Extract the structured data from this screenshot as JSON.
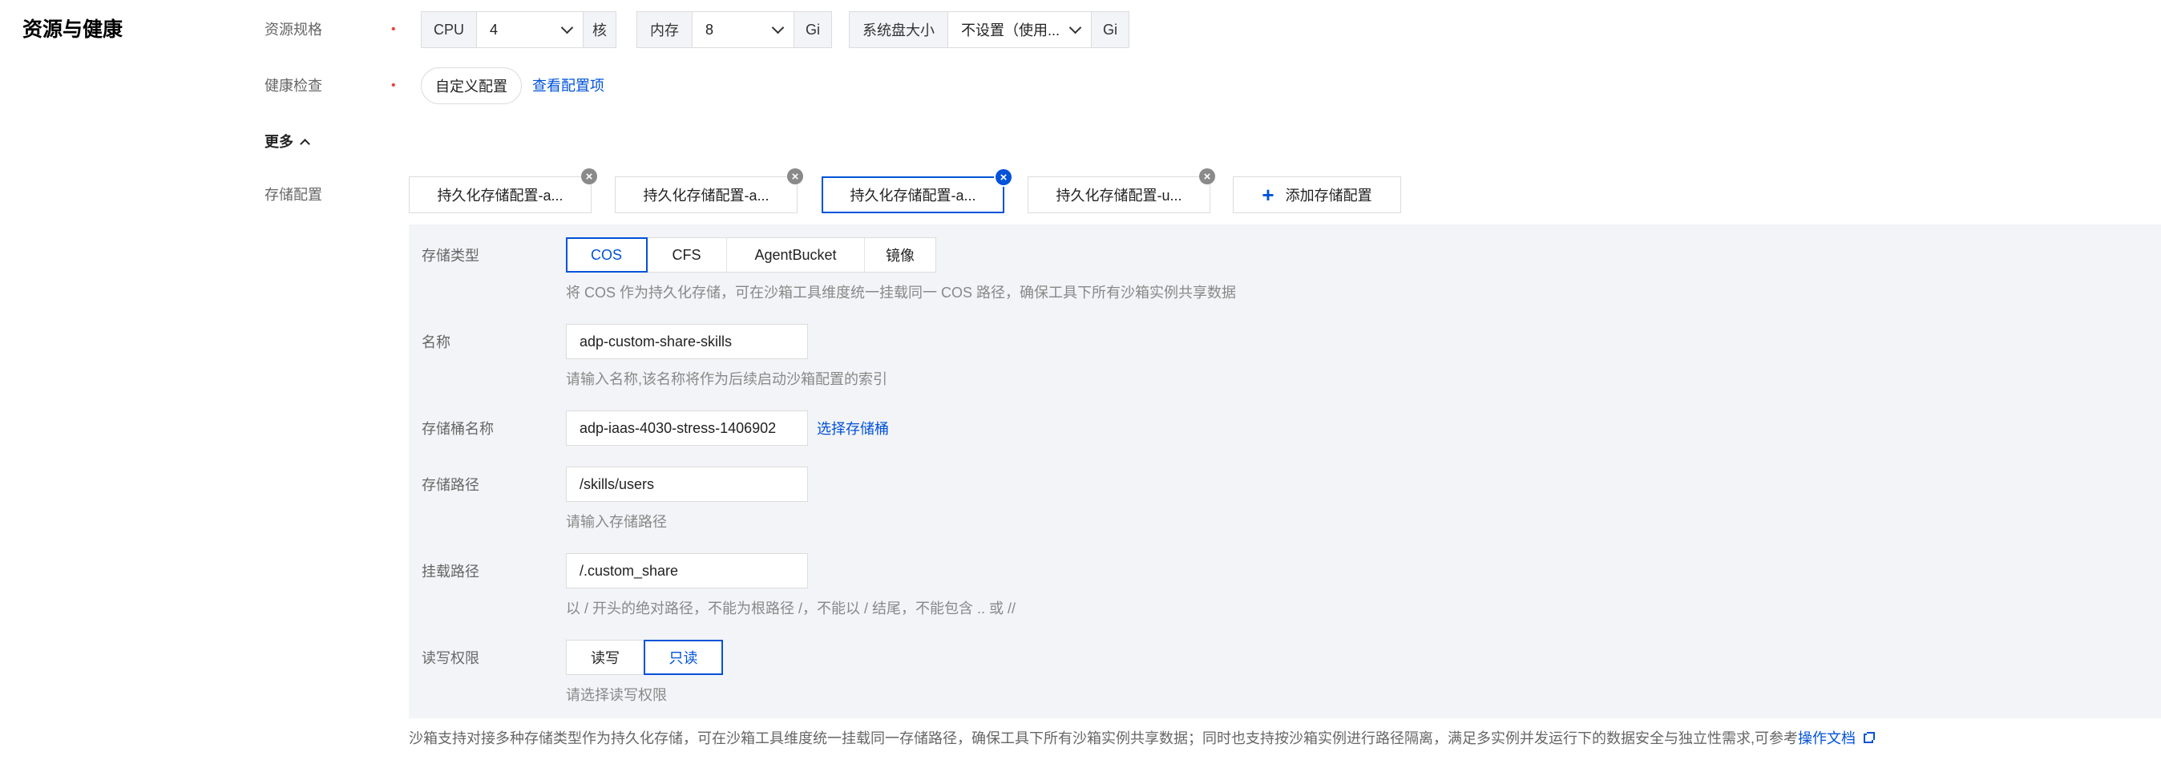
{
  "section_title": "资源与健康",
  "resource": {
    "label": "资源规格",
    "cpu": {
      "prefix": "CPU",
      "value": "4",
      "unit": "核"
    },
    "memory": {
      "prefix": "内存",
      "value": "8",
      "unit": "Gi"
    },
    "disk": {
      "prefix": "系统盘大小",
      "value": "不设置（使用...",
      "unit": "Gi"
    }
  },
  "health": {
    "label": "健康检查",
    "custom_button": "自定义配置",
    "view_link": "查看配置项"
  },
  "more_label": "更多",
  "storage": {
    "label": "存储配置",
    "tabs": [
      "持久化存储配置-a...",
      "持久化存储配置-a...",
      "持久化存储配置-a...",
      "持久化存储配置-u..."
    ],
    "active_tab_index": 2,
    "add_button": "添加存储配置",
    "form": {
      "type_label": "存储类型",
      "type_options": [
        "COS",
        "CFS",
        "AgentBucket",
        "镜像"
      ],
      "type_selected": "COS",
      "type_hint": "将 COS 作为持久化存储，可在沙箱工具维度统一挂载同一 COS 路径，确保工具下所有沙箱实例共享数据",
      "name_label": "名称",
      "name_value": "adp-custom-share-skills",
      "name_hint": "请输入名称,该名称将作为后续启动沙箱配置的索引",
      "bucket_label": "存储桶名称",
      "bucket_value": "adp-iaas-4030-stress-1406902",
      "bucket_link": "选择存储桶",
      "path_label": "存储路径",
      "path_value": "/skills/users",
      "path_hint": "请输入存储路径",
      "mount_label": "挂载路径",
      "mount_value": "/.custom_share",
      "mount_hint": "以 / 开头的绝对路径，不能为根路径 /，不能以 / 结尾，不能包含 .. 或 //",
      "perm_label": "读写权限",
      "perm_options": [
        "读写",
        "只读"
      ],
      "perm_selected": "只读",
      "perm_hint": "请选择读写权限"
    },
    "footer_note": "沙箱支持对接多种存储类型作为持久化存储，可在沙箱工具维度统一挂载同一存储路径，确保工具下所有沙箱实例共享数据；同时也支持按沙箱实例进行路径隔离，满足多实例并发运行下的数据安全与独立性需求,可参考",
    "footer_link": "操作文档"
  },
  "colors": {
    "accent": "#0052d9",
    "required": "#e54545",
    "panel_bg": "#f3f4f7"
  }
}
